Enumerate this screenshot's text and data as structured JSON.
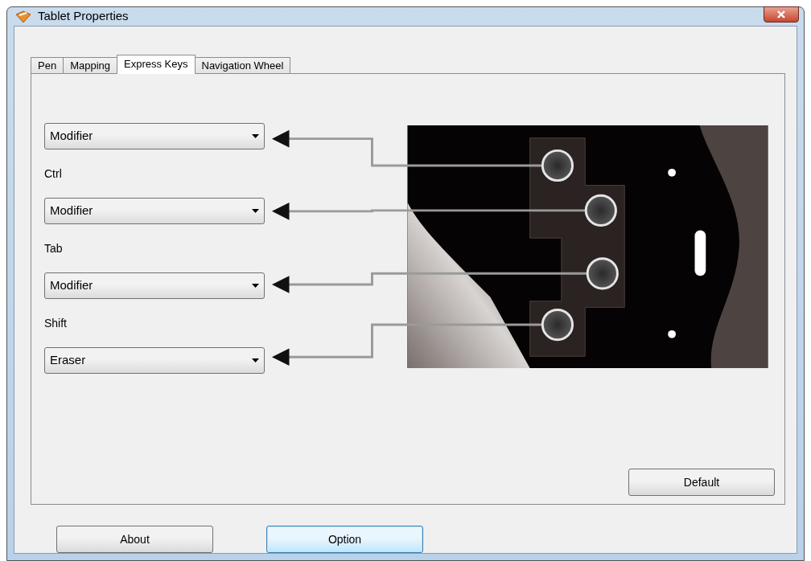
{
  "window": {
    "title": "Tablet Properties"
  },
  "tabs": [
    {
      "label": "Pen",
      "selected": false
    },
    {
      "label": "Mapping",
      "selected": false
    },
    {
      "label": "Express Keys",
      "selected": true
    },
    {
      "label": "Navigation Wheel",
      "selected": false
    }
  ],
  "keys": [
    {
      "value": "Modifier"
    },
    {
      "label": "Ctrl",
      "value": "Modifier"
    },
    {
      "label": "Tab",
      "value": "Modifier"
    },
    {
      "label": "Shift",
      "value": "Eraser"
    }
  ],
  "default_button": "Default",
  "buttons": [
    {
      "label": "About",
      "focused": false
    },
    {
      "label": "Option",
      "focused": true
    }
  ]
}
